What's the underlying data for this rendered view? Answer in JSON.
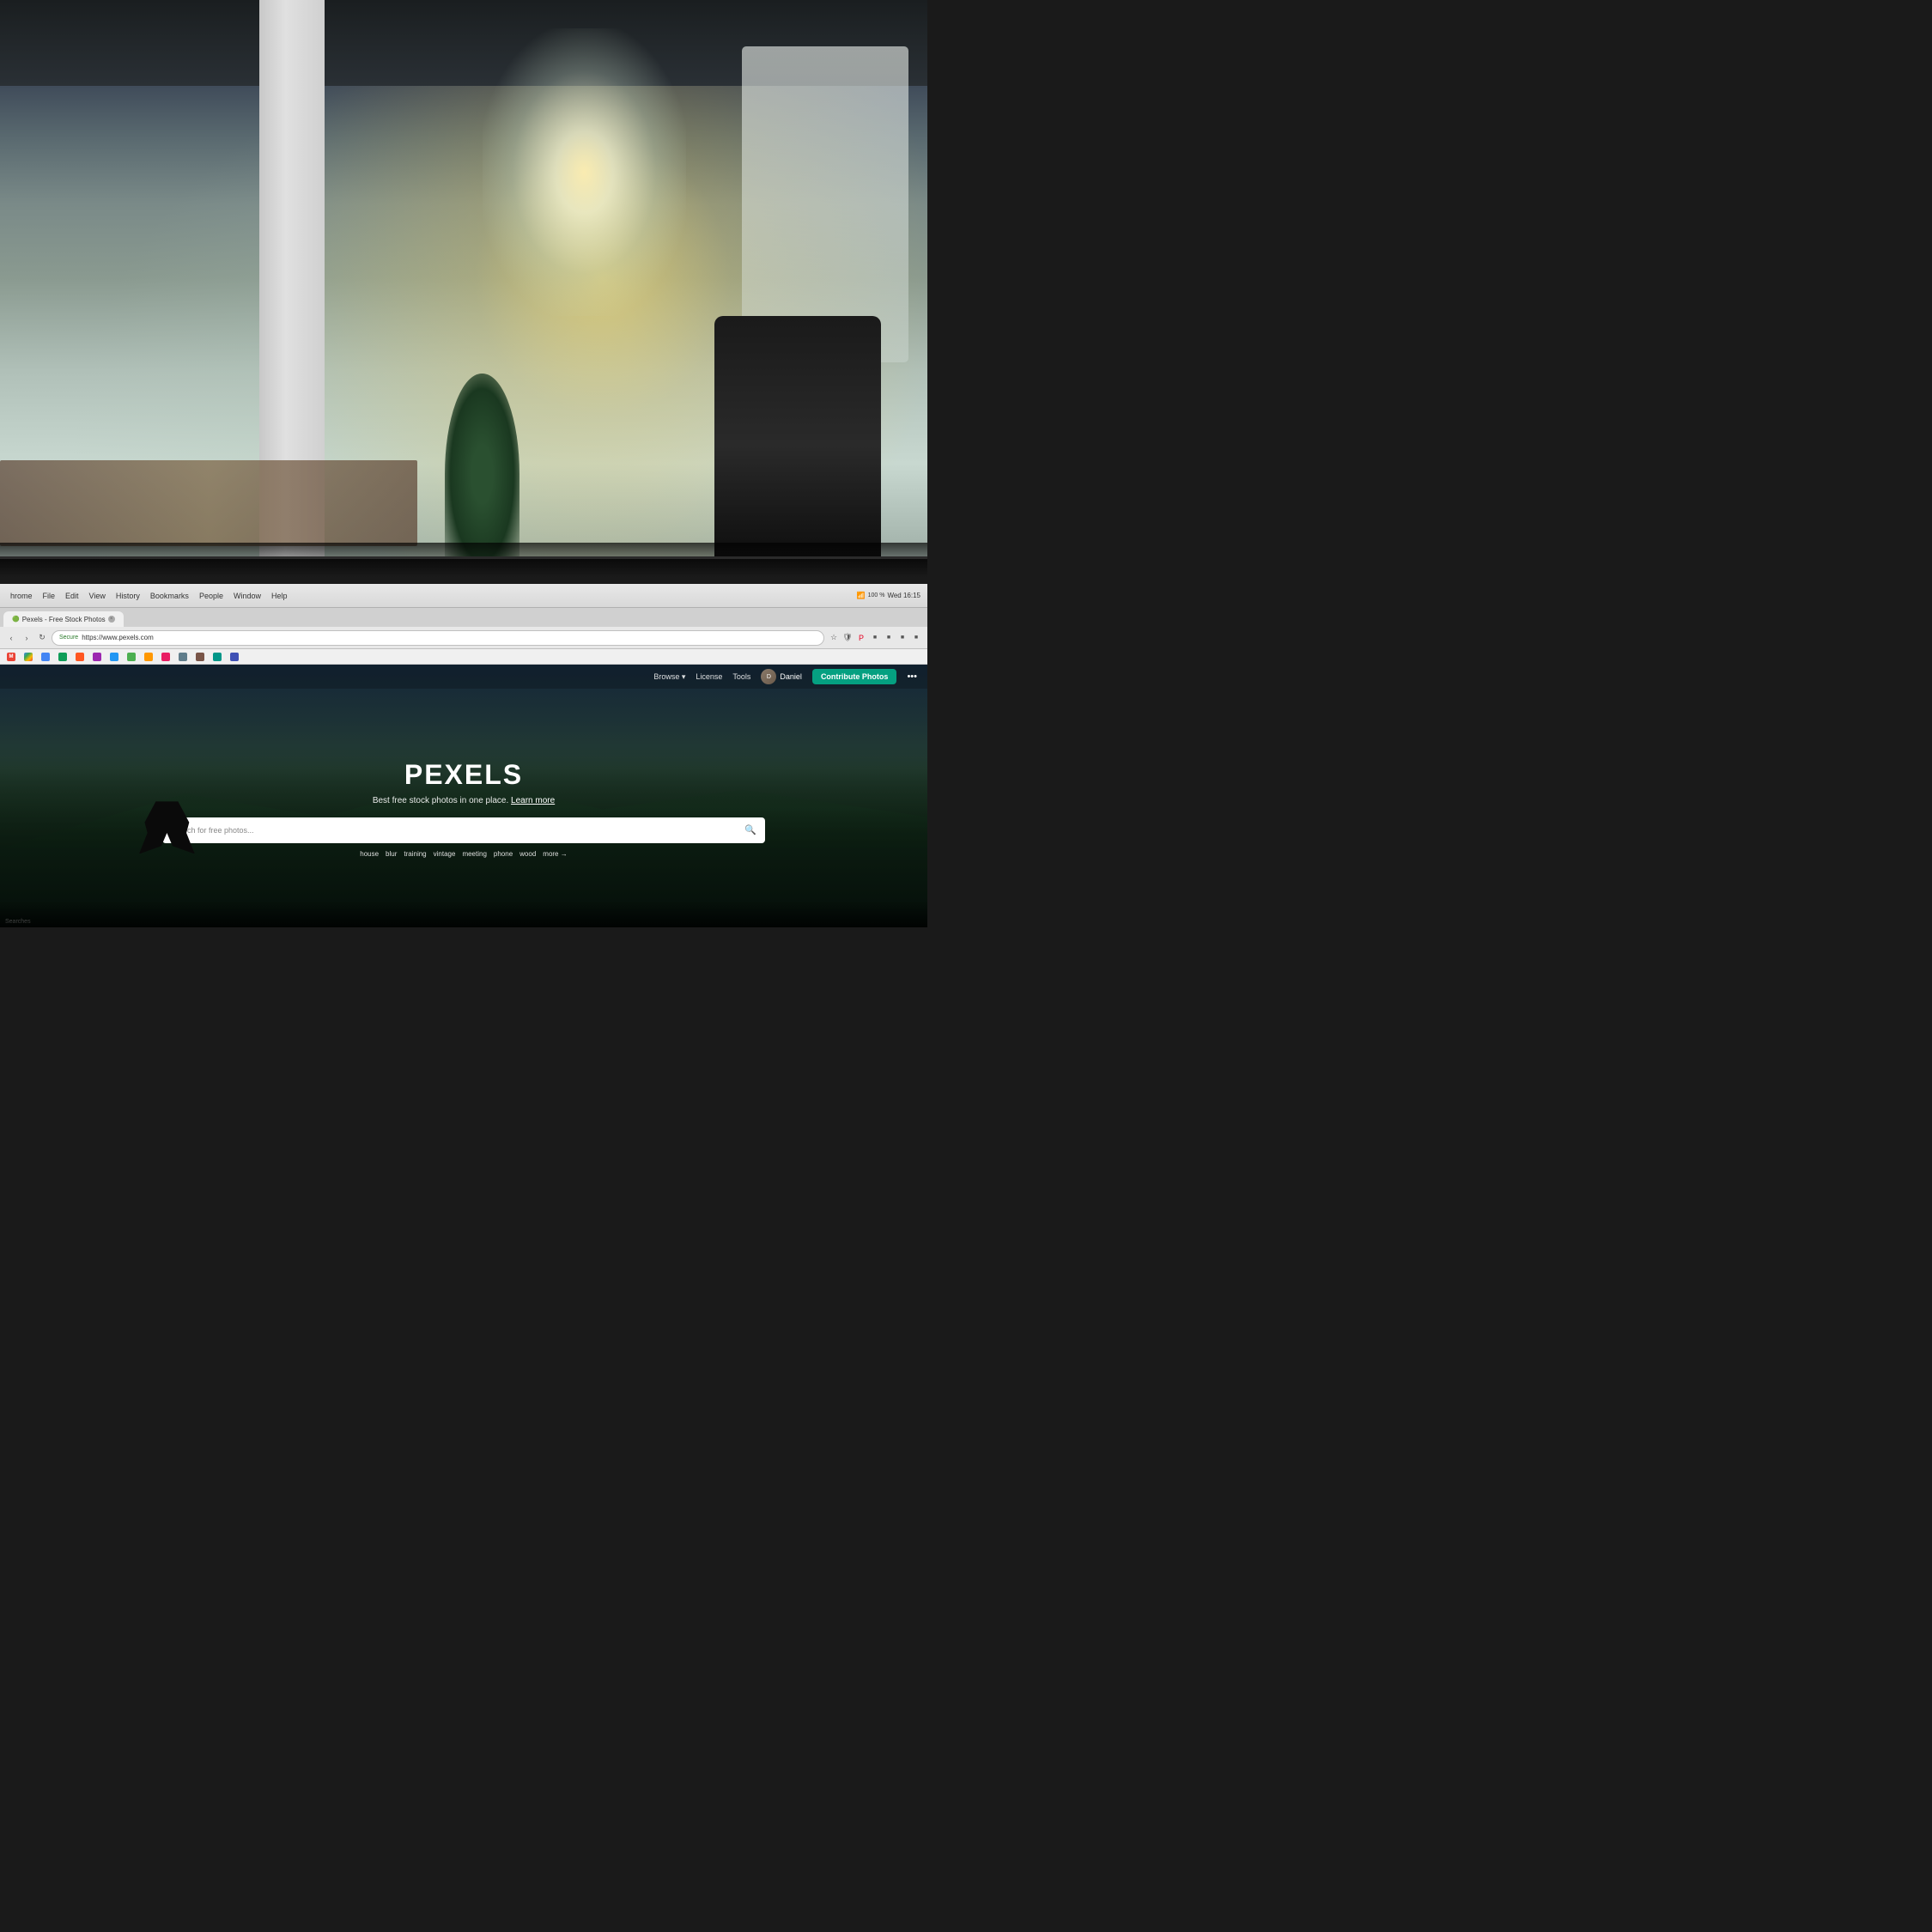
{
  "background": {
    "description": "Office background photo with industrial space, bright window glow, plants, desk chair"
  },
  "browser": {
    "title": "Pexels - Free Stock Photos",
    "url": "https://www.pexels.com",
    "secure_label": "Secure",
    "menu_items": [
      "hrome",
      "File",
      "Edit",
      "View",
      "History",
      "Bookmarks",
      "People",
      "Window",
      "Help"
    ],
    "time": "Wed 16:15",
    "battery": "100 %",
    "tab_label": "Pexels - Free Stock Photos",
    "close_icon": "×"
  },
  "bookmarks": {
    "items": [
      "M",
      "G",
      "■",
      "●",
      "◆",
      "▲",
      "■",
      "■",
      "■",
      "■",
      "■",
      "■",
      "■",
      "■",
      "■",
      "■",
      "■"
    ]
  },
  "pexels": {
    "logo": "PEXELS",
    "subtitle": "Best free stock photos in one place.",
    "learn_more": "Learn more",
    "search_placeholder": "Search for free photos...",
    "nav": {
      "browse": "Browse",
      "browse_dropdown": "▾",
      "license": "License",
      "tools": "Tools",
      "user": "Daniel",
      "contribute": "Contribute Photos",
      "more_dots": "•••"
    },
    "search_tags": [
      "house",
      "blur",
      "training",
      "vintage",
      "meeting",
      "phone",
      "wood",
      "more →"
    ]
  },
  "status_bar": {
    "searches_label": "Searches"
  }
}
